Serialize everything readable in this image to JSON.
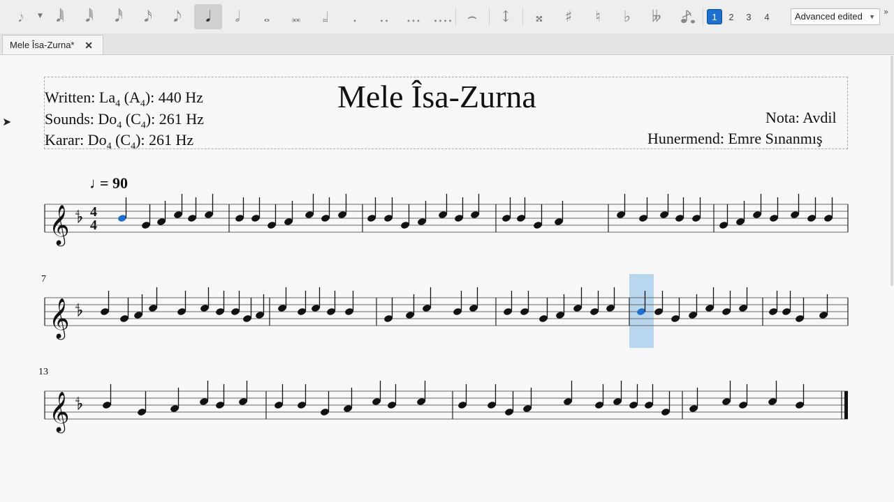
{
  "toolbar": {
    "note_input_icon": "𝆕",
    "durations": [
      "𝅘𝅥𝅲",
      "𝅘𝅥𝅱",
      "𝅘𝅥𝅰",
      "𝅘𝅥𝅯",
      "𝅘𝅥𝅮",
      "𝅘𝅥",
      "𝅗𝅥",
      "𝅝",
      "𝅜",
      "𝆷"
    ],
    "dots": [
      ".",
      "..",
      "...",
      "...."
    ],
    "tie_icon": "⌢",
    "flip_icon": "↕",
    "accidentals": [
      "𝄪",
      "♯",
      "♮",
      "♭",
      "𝄫"
    ],
    "voices": [
      "1",
      "2",
      "3",
      "4"
    ],
    "workspace": "Advanced edited",
    "more": "»"
  },
  "tab": {
    "title": "Mele Îsa-Zurna*",
    "close": "✕"
  },
  "score": {
    "title": "Mele Îsa-Zurna",
    "written": "Written: La₄ (A₄): 440 Hz",
    "sounds": "Sounds: Do₄ (C₄): 261 Hz",
    "karar": "Karar: Do₄ (C₄): 261 Hz",
    "nota": "Nota: Avdil",
    "hunermend": "Hunermend: Emre Sınanmış",
    "tempo_equals": "= 90",
    "time_sig_top": "4",
    "time_sig_bottom": "4",
    "measure_numbers": [
      "7",
      "13"
    ]
  },
  "colors": {
    "selection": "#1f6fcf",
    "highlight": "#b9d6ef",
    "text": "#111111"
  }
}
